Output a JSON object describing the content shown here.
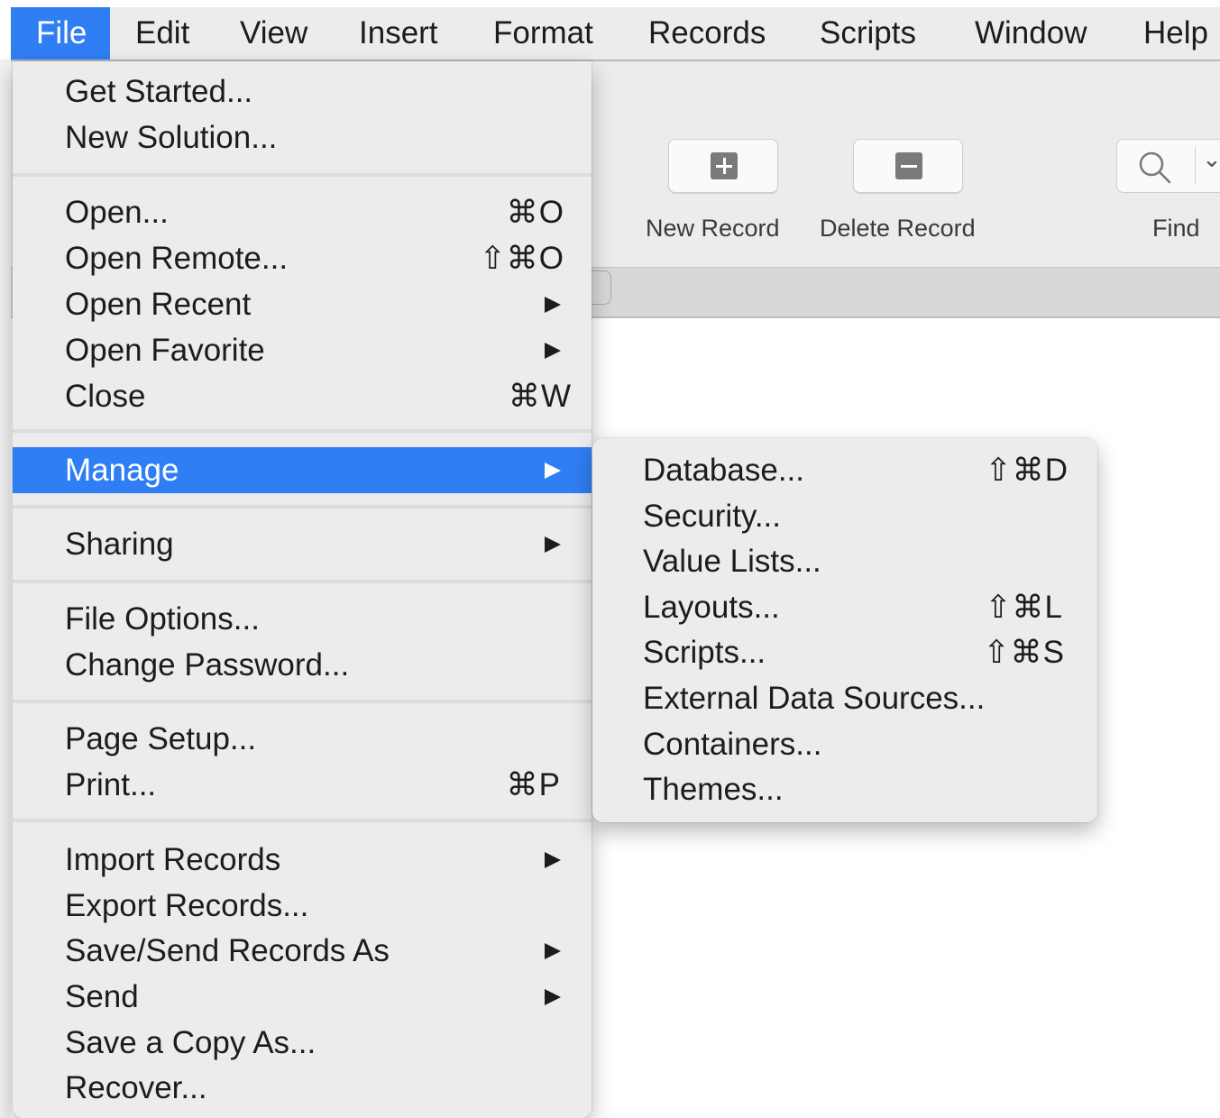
{
  "menubar": {
    "items": [
      "File",
      "Edit",
      "View",
      "Insert",
      "Format",
      "Records",
      "Scripts",
      "Window",
      "Help"
    ],
    "active": "File"
  },
  "toolbar": {
    "new_record": "New Record",
    "delete_record": "Delete Record",
    "find": "Find"
  },
  "file_menu": {
    "items": [
      {
        "label": "Get Started..."
      },
      {
        "label": "New Solution..."
      },
      {
        "label": "Open...",
        "shortcut": "⌘O"
      },
      {
        "label": "Open Remote...",
        "shortcut": "⇧⌘O"
      },
      {
        "label": "Open Recent",
        "submenu": true
      },
      {
        "label": "Open Favorite",
        "submenu": true
      },
      {
        "label": "Close",
        "shortcut": "⌘W"
      },
      {
        "label": "Manage",
        "submenu": true,
        "highlighted": true
      },
      {
        "label": "Sharing",
        "submenu": true
      },
      {
        "label": "File Options..."
      },
      {
        "label": "Change Password..."
      },
      {
        "label": "Page Setup..."
      },
      {
        "label": "Print...",
        "shortcut": "⌘P"
      },
      {
        "label": "Import Records",
        "submenu": true
      },
      {
        "label": "Export Records..."
      },
      {
        "label": "Save/Send Records As",
        "submenu": true
      },
      {
        "label": "Send",
        "submenu": true
      },
      {
        "label": "Save a Copy As..."
      },
      {
        "label": "Recover..."
      }
    ]
  },
  "manage_menu": {
    "items": [
      {
        "label": "Database...",
        "shortcut": "⇧⌘D"
      },
      {
        "label": "Security..."
      },
      {
        "label": "Value Lists..."
      },
      {
        "label": "Layouts...",
        "shortcut": "⇧⌘L"
      },
      {
        "label": "Scripts...",
        "shortcut": "⇧⌘S"
      },
      {
        "label": "External Data Sources..."
      },
      {
        "label": "Containers..."
      },
      {
        "label": "Themes..."
      }
    ]
  },
  "colors": {
    "highlight": "#2f7ef3",
    "menu_bg": "#ececec",
    "text": "#1c1c1c"
  }
}
